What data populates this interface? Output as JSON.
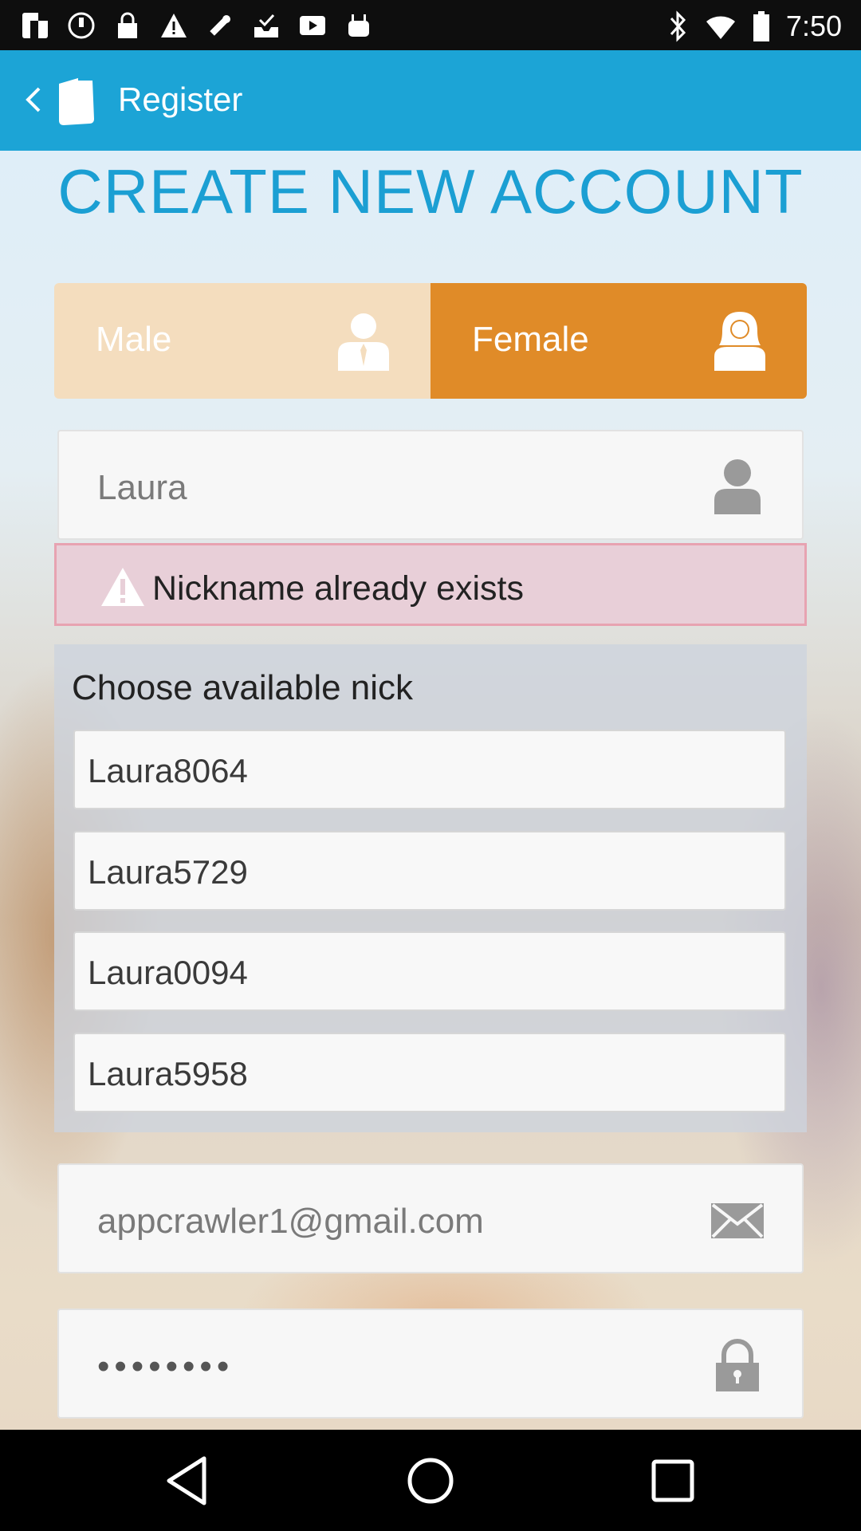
{
  "status_bar": {
    "time": "7:50",
    "icons": [
      "flipboard-icon",
      "sync-icon",
      "lock-icon",
      "warning-icon",
      "fake-gps-icon",
      "inbox-check-icon",
      "youtube-icon",
      "android-icon",
      "bluetooth-icon",
      "wifi-icon",
      "battery-icon"
    ]
  },
  "action_bar": {
    "title": "Register",
    "icons": [
      "back-arrow-icon",
      "app-logo-icon"
    ]
  },
  "main": {
    "heading": "CREATE NEW ACCOUNT",
    "gender": {
      "male_label": "Male",
      "female_label": "Female",
      "selected": "Female",
      "colors": {
        "male_bg": "#f4ddbe",
        "female_bg": "#e08b28"
      }
    },
    "nickname_field": {
      "value": "Laura",
      "icon": "person-icon"
    },
    "error": {
      "message": "Nickname already exists",
      "icon": "warning-triangle-icon",
      "colors": {
        "bg": "#e8cfd8",
        "border": "#e7a3b1"
      }
    },
    "nick_suggestions": {
      "title": "Choose available nick",
      "options": [
        "Laura8064",
        "Laura5729",
        "Laura0094",
        "Laura5958"
      ]
    },
    "email_field": {
      "value": "appcrawler1@gmail.com",
      "icon": "envelope-icon"
    },
    "password_field": {
      "value": "••••••••",
      "icon": "padlock-icon"
    }
  },
  "nav_bar": {
    "icons": [
      "back-triangle-icon",
      "home-circle-icon",
      "recents-square-icon"
    ]
  },
  "colors": {
    "accent": "#1ca4d6",
    "heading": "#1b9fd3",
    "orange": "#e08b28"
  }
}
